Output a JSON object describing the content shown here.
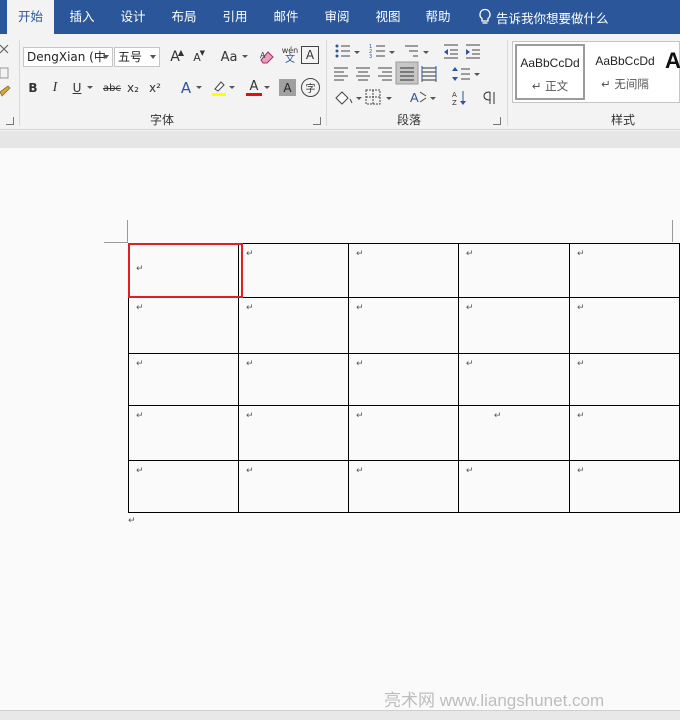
{
  "tabs": [
    {
      "label": "开始",
      "active": true
    },
    {
      "label": "插入"
    },
    {
      "label": "设计"
    },
    {
      "label": "布局"
    },
    {
      "label": "引用"
    },
    {
      "label": "邮件"
    },
    {
      "label": "审阅"
    },
    {
      "label": "视图"
    },
    {
      "label": "帮助"
    }
  ],
  "tell_me": "告诉我你想要做什么",
  "ribbon": {
    "font_name": "DengXian (中",
    "font_size": "五号",
    "font_group_label": "字体",
    "paragraph_group_label": "段落",
    "styles_group_label": "样式",
    "aa_label": "Aa",
    "pinyin_top": "wén",
    "pinyin_bottom": "文",
    "bold": "B",
    "italic": "I",
    "underline": "U",
    "strike": "abc",
    "subscript": "x₂",
    "superscript": "x²",
    "char_border": "A",
    "enclose_char": "字",
    "text_effect": "A",
    "font_color": "A",
    "char_shade": "A",
    "grow_font": "A",
    "shrink_font": "A",
    "styles": [
      {
        "sample": "AaBbCcDd",
        "name": "↵ 正文",
        "selected": true
      },
      {
        "sample": "AaBbCcDd",
        "name": "↵ 无间隔"
      }
    ],
    "style_big": "A",
    "colors": {
      "highlight": "#ffff00",
      "font": "#e01010",
      "accent": "#2b579a"
    }
  },
  "table": {
    "rows": [
      [
        "↵",
        "↵",
        "↵",
        "↵",
        "↵"
      ],
      [
        "↵",
        "↵",
        "↵",
        "↵",
        "↵"
      ],
      [
        "↵",
        "↵",
        "↵",
        "↵",
        "↵"
      ],
      [
        "↵",
        "↵",
        "↵",
        "↵",
        "↵"
      ],
      [
        "↵",
        "↵",
        "↵",
        "↵",
        "↵"
      ]
    ],
    "selected_cell": [
      0,
      0
    ]
  },
  "paragraph_mark": "↵",
  "watermark": "亮术网 www.liangshunet.com"
}
